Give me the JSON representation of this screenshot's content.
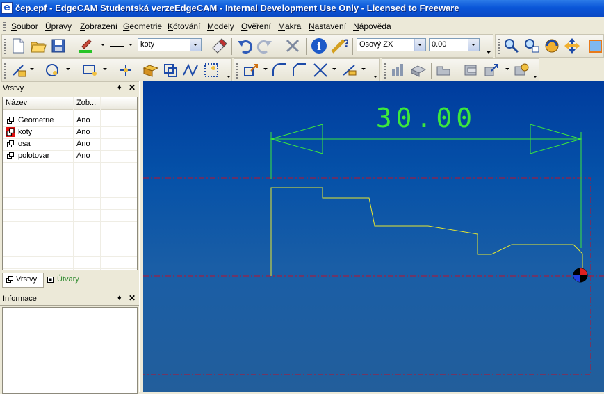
{
  "window": {
    "icon_glyph": "e",
    "title": "čep.epf - EdgeCAM Studentská verzeEdgeCAM - Internal Development Use Only - Licensed to Freeware"
  },
  "menu": [
    {
      "first": "S",
      "rest": "oubor"
    },
    {
      "first": "Ú",
      "rest": "pravy"
    },
    {
      "first": "Z",
      "rest": "obrazení"
    },
    {
      "first": "G",
      "rest": "eometrie"
    },
    {
      "first": "K",
      "rest": "ótování"
    },
    {
      "first": "M",
      "rest": "odely"
    },
    {
      "first": "O",
      "rest": "věření"
    },
    {
      "first": "M",
      "rest": "akra"
    },
    {
      "first": "N",
      "rest": "astavení"
    },
    {
      "first": "N",
      "rest": "ápověda"
    }
  ],
  "toolbar": {
    "layer_combo": "koty",
    "view_combo": "Osový ZX",
    "value_combo": "0.00"
  },
  "layers_panel": {
    "title": "Vrstvy",
    "pin": "♦",
    "close": "✕",
    "col_name": "Název",
    "col_visible": "Zob...",
    "rows": [
      {
        "name": "Geometrie",
        "visible": "Ano"
      },
      {
        "name": "koty",
        "visible": "Ano"
      },
      {
        "name": "osa",
        "visible": "Ano"
      },
      {
        "name": "polotovar",
        "visible": "Ano"
      }
    ],
    "tab_layers": "Vrstvy",
    "tab_shapes": "Útvary"
  },
  "info_panel": {
    "title": "Informace",
    "pin": "♦",
    "close": "✕"
  },
  "viewport": {
    "dimension_text": "30.00",
    "colors": {
      "background_top": "#003C9E",
      "dimension": "#3CE83C",
      "profile": "#E8E830",
      "stock": "#C0102A"
    }
  }
}
